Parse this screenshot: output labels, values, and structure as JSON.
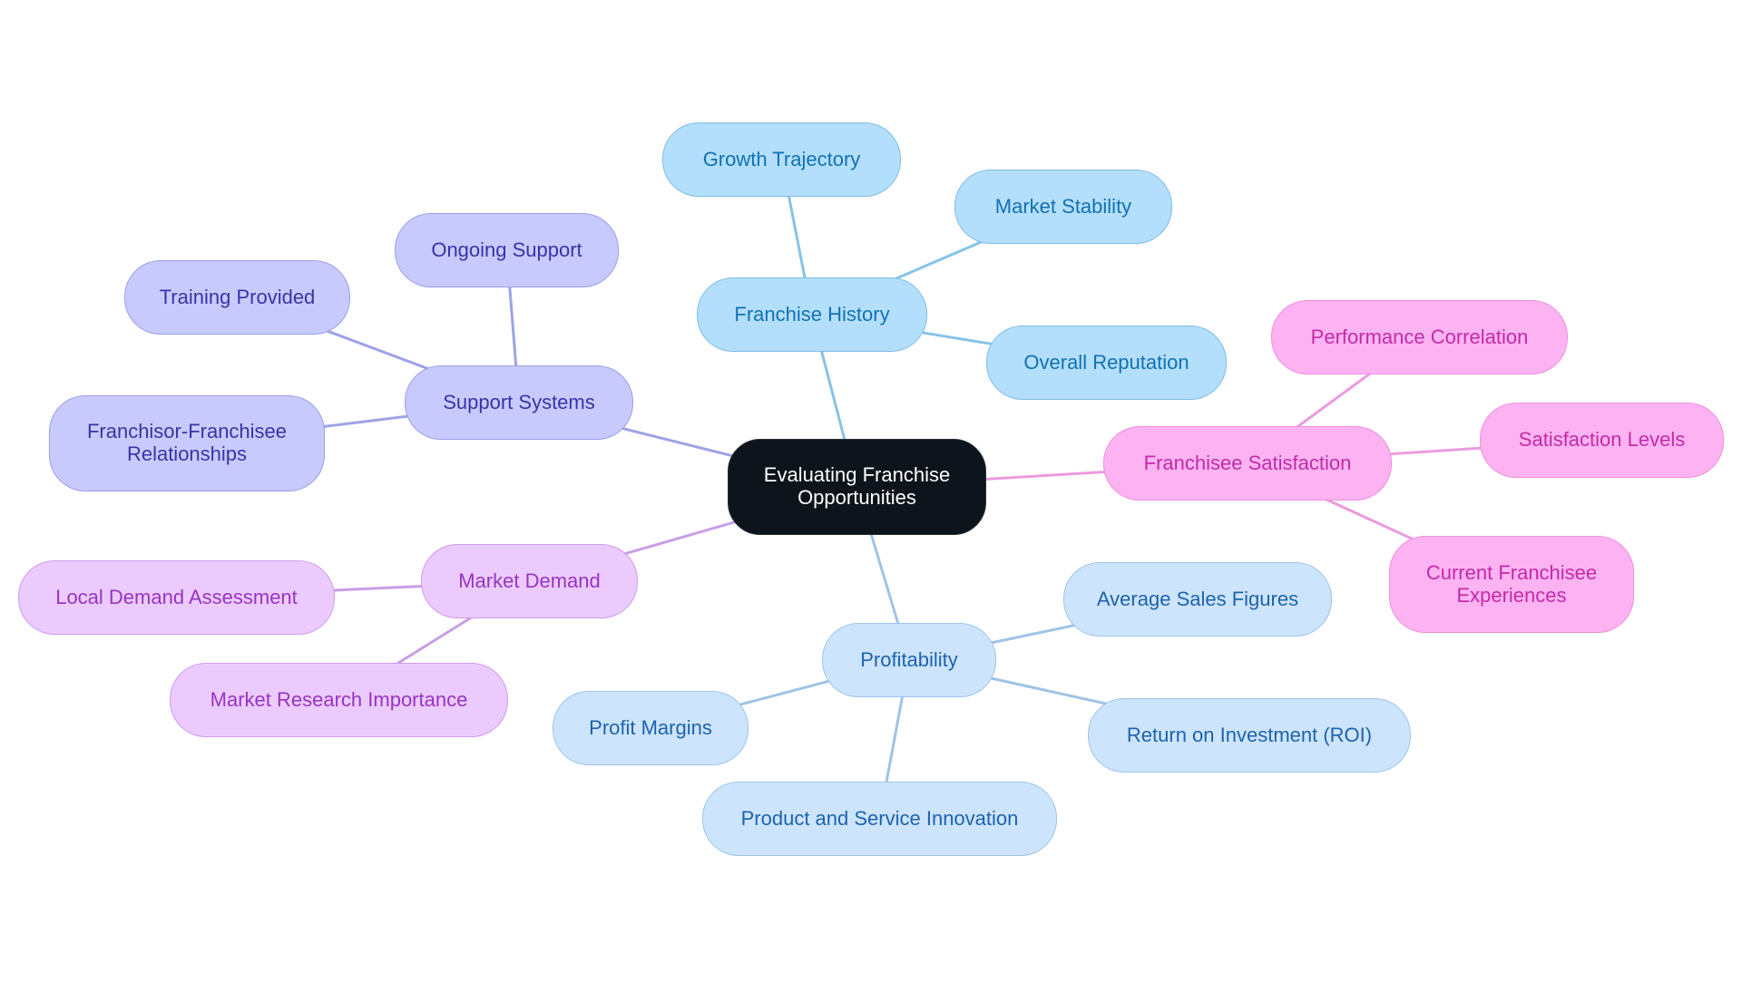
{
  "title": "Evaluating Franchise Opportunities",
  "colors": {
    "root": "#0d141b",
    "franchise_history": "#b3dffc",
    "support_systems": "#c8cafd",
    "franchisee_satisfaction": "#fdb3f2",
    "market_demand": "#ebcbfd",
    "profitability": "#cde4fd",
    "edge_blue": "#86c3e8",
    "edge_indigo": "#9ea3e6",
    "edge_pink": "#eb9be0",
    "edge_violet": "#c99ee8",
    "edge_lightblue": "#9fc3e6"
  },
  "root": {
    "label": "Evaluating Franchise\nOpportunities"
  },
  "branches": [
    {
      "label": "Franchise History",
      "children": [
        "Growth Trajectory",
        "Market Stability",
        "Overall Reputation"
      ]
    },
    {
      "label": "Support Systems",
      "children": [
        "Ongoing Support",
        "Training Provided",
        "Franchisor-Franchisee\nRelationships"
      ]
    },
    {
      "label": "Franchisee Satisfaction",
      "children": [
        "Performance Correlation",
        "Satisfaction Levels",
        "Current Franchisee\nExperiences"
      ]
    },
    {
      "label": "Market Demand",
      "children": [
        "Local Demand Assessment",
        "Market Research Importance"
      ]
    },
    {
      "label": "Profitability",
      "children": [
        "Average Sales Figures",
        "Profit Margins",
        "Return on Investment (ROI)",
        "Product and Service Innovation"
      ]
    }
  ]
}
